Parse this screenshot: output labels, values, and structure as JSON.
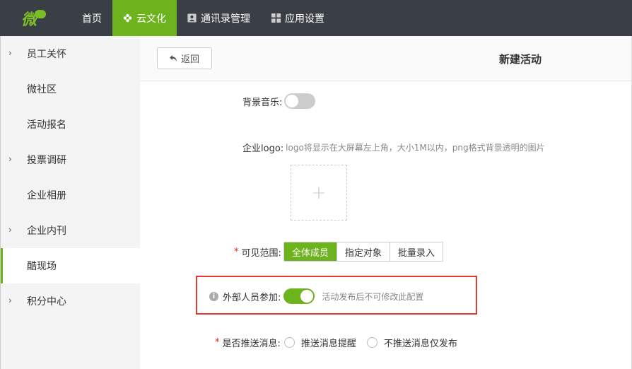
{
  "logo": {
    "text": "微"
  },
  "nav": {
    "items": [
      {
        "label": "首页"
      },
      {
        "label": "云文化"
      },
      {
        "label": "通讯录管理"
      },
      {
        "label": "应用设置"
      }
    ]
  },
  "sidebar": {
    "items": [
      {
        "label": "员工关怀",
        "chevron": "›"
      },
      {
        "label": "微社区"
      },
      {
        "label": "活动报名"
      },
      {
        "label": "投票调研",
        "chevron": "›"
      },
      {
        "label": "企业相册"
      },
      {
        "label": "企业内刊",
        "chevron": "›"
      },
      {
        "label": "酷现场"
      },
      {
        "label": "积分中心",
        "chevron": "›"
      }
    ]
  },
  "header": {
    "back_label": "返回",
    "title": "新建活动"
  },
  "form": {
    "music_label": "背景音乐:",
    "logo_label": "企业logo:",
    "logo_hint": "logo将显示在大屏幕左上角，大小1M以内，png格式背景透明的图片",
    "scope_label": "可见范围:",
    "scope_options": [
      "全体成员",
      "指定对象",
      "批量录入"
    ],
    "external_label": "外部人员参加:",
    "external_hint": "活动发布后不可修改此配置",
    "push_label": "是否推送消息:",
    "push_options": [
      "推送消息提醒",
      "不推送消息仅发布"
    ],
    "required_mark": "*",
    "plus": "+"
  },
  "colors": {
    "accent": "#6cb31d",
    "topbar": "#3a3f45",
    "highlight": "#e53935"
  }
}
